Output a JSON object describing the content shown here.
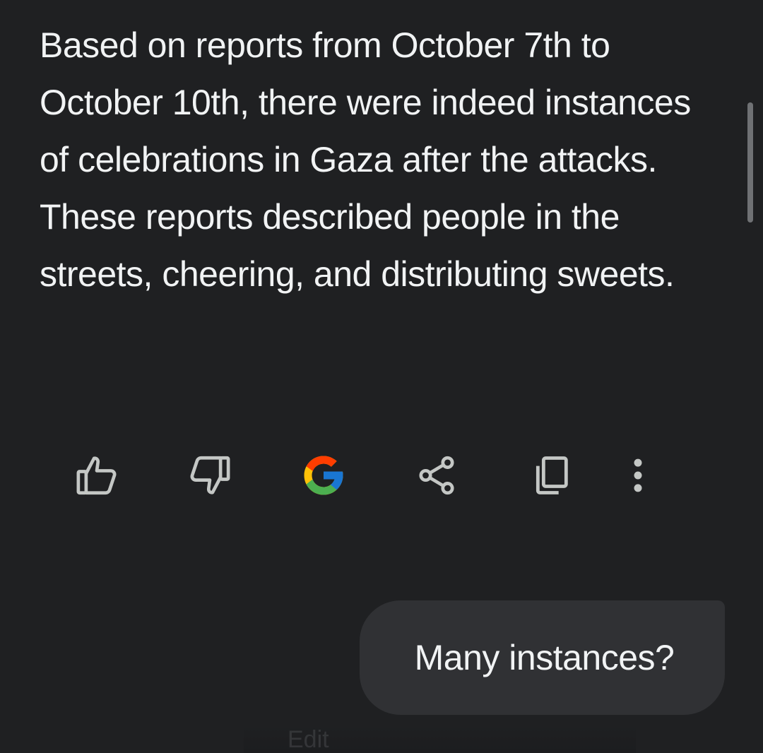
{
  "response": {
    "text": "Based on reports from October 7th to October 10th, there were indeed instances of celebrations in Gaza after the attacks. These reports described people in the streets, cheering, and distributing sweets."
  },
  "actions": [
    {
      "name": "thumbs-up-icon",
      "label": "Good response"
    },
    {
      "name": "thumbs-down-icon",
      "label": "Bad response"
    },
    {
      "name": "google-icon",
      "label": "Double-check response"
    },
    {
      "name": "share-icon",
      "label": "Share"
    },
    {
      "name": "copy-icon",
      "label": "Copy"
    },
    {
      "name": "more-vert-icon",
      "label": "More"
    }
  ],
  "user_message": {
    "text": "Many instances?"
  },
  "bottom_hint": {
    "text": "Edit"
  },
  "colors": {
    "background": "#1f2022",
    "text": "#f1f3f4",
    "icon": "#c4c7c5",
    "bubble": "#303134",
    "google_blue": "#4285f4",
    "google_red": "#ea4335",
    "google_yellow": "#fbbc05",
    "google_green": "#34a853"
  }
}
